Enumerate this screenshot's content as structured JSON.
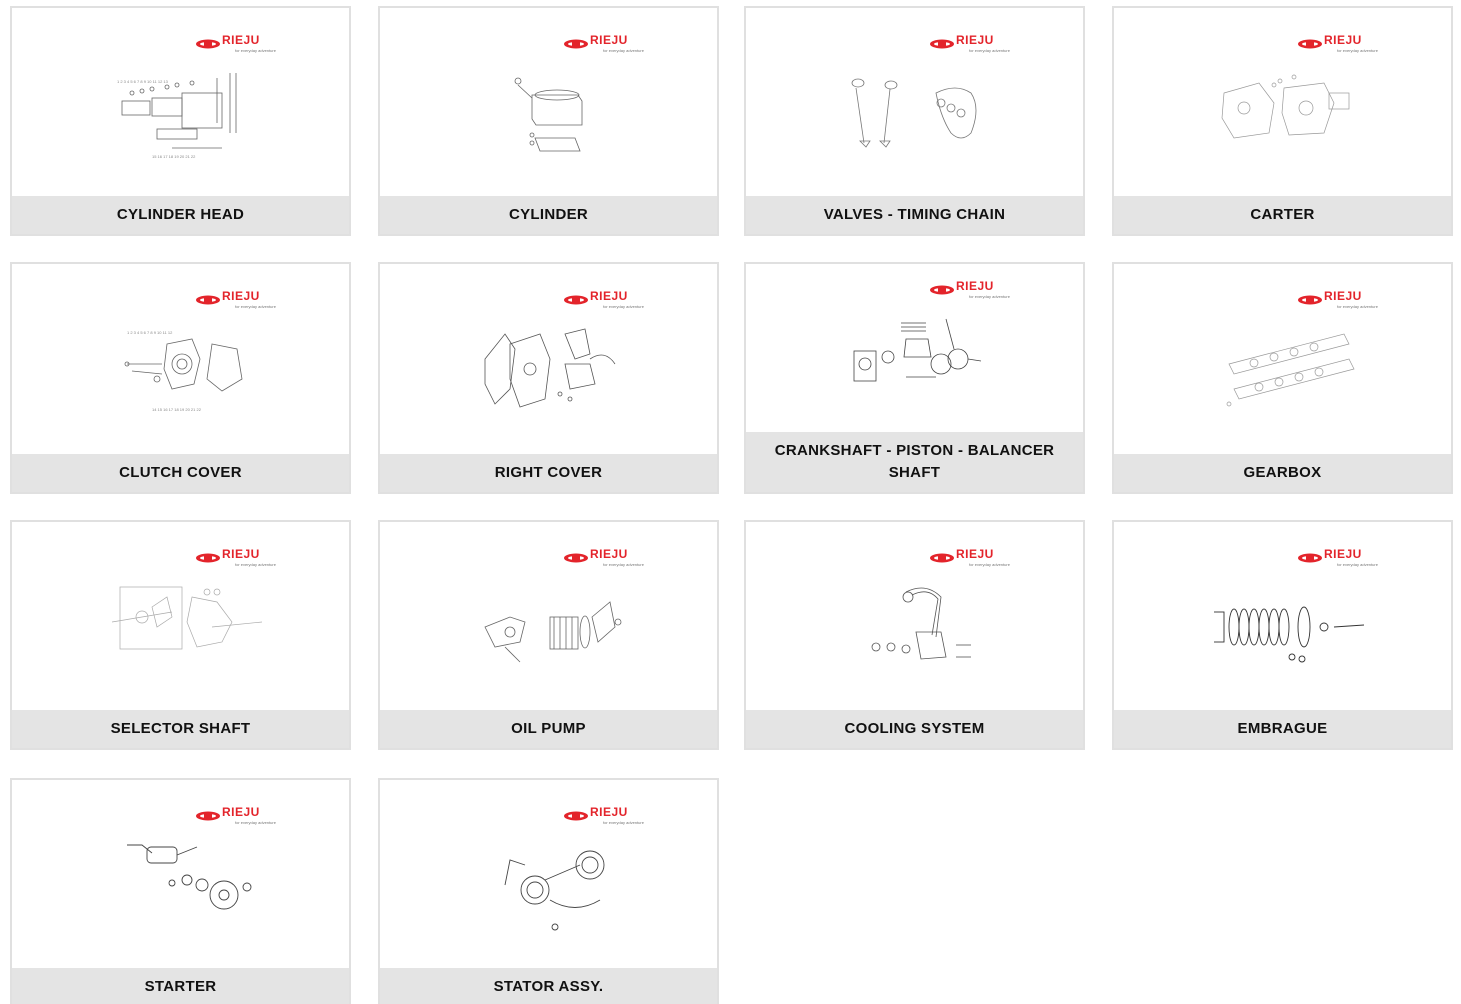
{
  "brand": {
    "name": "RIEJU",
    "tagline": "for everyday adventure",
    "accent_color": "#e3242b"
  },
  "cards": [
    {
      "label": "CYLINDER HEAD",
      "icon": "cylinder-head-diagram-icon"
    },
    {
      "label": "CYLINDER",
      "icon": "cylinder-diagram-icon"
    },
    {
      "label": "VALVES - TIMING CHAIN",
      "icon": "valves-timing-chain-diagram-icon"
    },
    {
      "label": "CARTER",
      "icon": "carter-diagram-icon"
    },
    {
      "label": "CLUTCH COVER",
      "icon": "clutch-cover-diagram-icon"
    },
    {
      "label": "RIGHT COVER",
      "icon": "right-cover-diagram-icon"
    },
    {
      "label": "CRANKSHAFT - PISTON - BALANCER SHAFT",
      "icon": "crankshaft-piston-diagram-icon"
    },
    {
      "label": "GEARBOX",
      "icon": "gearbox-diagram-icon"
    },
    {
      "label": "SELECTOR SHAFT",
      "icon": "selector-shaft-diagram-icon"
    },
    {
      "label": "OIL PUMP",
      "icon": "oil-pump-diagram-icon"
    },
    {
      "label": "COOLING SYSTEM",
      "icon": "cooling-system-diagram-icon"
    },
    {
      "label": "EMBRAGUE",
      "icon": "embrague-diagram-icon"
    },
    {
      "label": "STARTER",
      "icon": "starter-diagram-icon"
    },
    {
      "label": "STATOR ASSY.",
      "icon": "stator-diagram-icon"
    }
  ]
}
